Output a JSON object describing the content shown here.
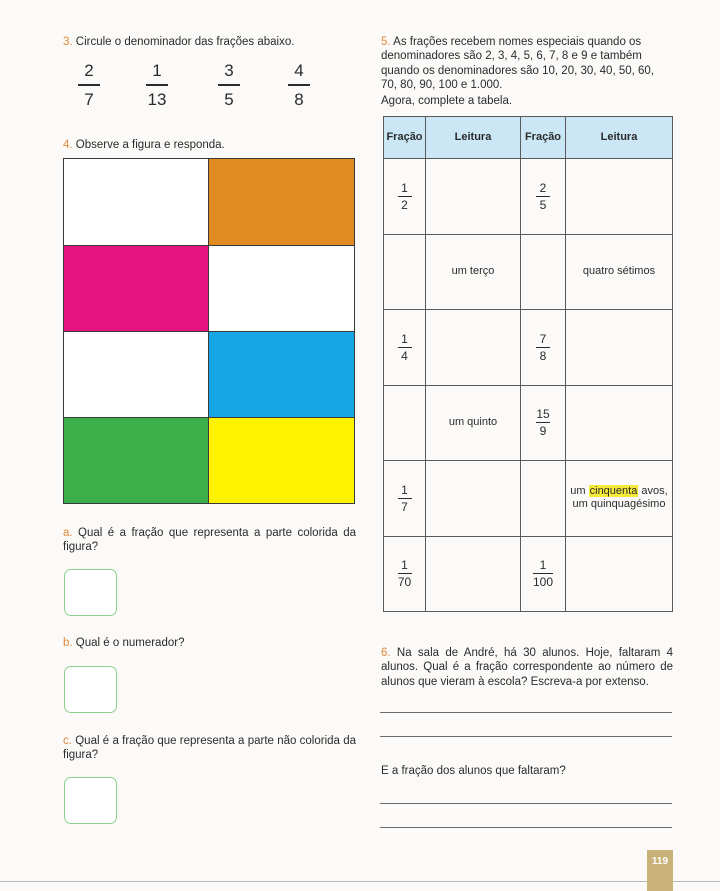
{
  "q3": {
    "number": "3.",
    "text": "Circule o denominador das frações abaixo.",
    "fractions": [
      {
        "num": "2",
        "den": "7"
      },
      {
        "num": "1",
        "den": "13"
      },
      {
        "num": "3",
        "den": "5"
      },
      {
        "num": "4",
        "den": "8"
      }
    ]
  },
  "q4": {
    "number": "4.",
    "text": "Observe a figura e responda.",
    "grid_colors": [
      "#ffffff",
      "#e08a22",
      "#e5137d",
      "#ffffff",
      "#ffffff",
      "#16a6e6",
      "#3cae4a",
      "#fff200"
    ],
    "a_letter": "a.",
    "a_text": "Qual é a fração que representa a parte colorida da figura?",
    "b_letter": "b.",
    "b_text": "Qual é o numerador?",
    "c_letter": "c.",
    "c_text": "Qual é a fração que representa a parte não colorida da figura?"
  },
  "q5": {
    "number": "5.",
    "text": "As frações recebem nomes especiais quando os denominadores são 2, 3, 4, 5, 6, 7, 8 e 9 e também quando os denominadores são 10, 20, 30, 40, 50, 60, 70, 80, 90, 100 e 1.000.",
    "instruction": "Agora, complete a tabela.",
    "headers": [
      "Fração",
      "Leitura",
      "Fração",
      "Leitura"
    ],
    "rows": [
      {
        "f1": {
          "num": "1",
          "den": "2"
        },
        "l1": "",
        "f2": {
          "num": "2",
          "den": "5"
        },
        "l2": ""
      },
      {
        "f1": null,
        "l1": "um terço",
        "f2": null,
        "l2": "quatro sétimos"
      },
      {
        "f1": {
          "num": "1",
          "den": "4"
        },
        "l1": "",
        "f2": {
          "num": "7",
          "den": "8"
        },
        "l2": ""
      },
      {
        "f1": null,
        "l1": "um quinto",
        "f2": {
          "num": "15",
          "den": "9"
        },
        "l2": ""
      },
      {
        "f1": {
          "num": "1",
          "den": "7"
        },
        "l1": "",
        "f2": null,
        "l2_pre": "um ",
        "l2_hl": "cinquenta",
        "l2_post": " avos,",
        "l2_line2": "um quinquagésimo"
      },
      {
        "f1": {
          "num": "1",
          "den": "70"
        },
        "l1": "",
        "f2": {
          "num": "1",
          "den": "100"
        },
        "l2": ""
      }
    ]
  },
  "q6": {
    "number": "6.",
    "text": "Na sala de André, há 30 alunos. Hoje, faltaram 4 alunos. Qual é a fração correspondente ao número de alunos que vieram à escola? Escreva-a por extenso.",
    "followup": "E a fração dos alunos que faltaram?"
  },
  "page": {
    "number": "119"
  }
}
